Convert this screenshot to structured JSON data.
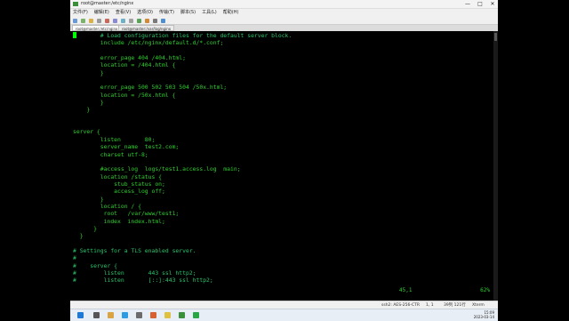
{
  "window": {
    "title": "root@master:/etc/nginx",
    "controls": [
      "—",
      "□",
      "✕"
    ]
  },
  "menu": [
    "文件(F)",
    "编辑(E)",
    "查看(V)",
    "选项(O)",
    "传输(T)",
    "脚本(S)",
    "工具(L)",
    "帮助(H)"
  ],
  "tabs": [
    {
      "label": "root@master:/etc/nginx",
      "active": true
    },
    {
      "label": "root@master:/var/log/nginx",
      "active": false
    }
  ],
  "terminal": {
    "lines": [
      {
        "text": "        # Load configuration files for the default server block.",
        "kind": "comment"
      },
      {
        "text": "        include /etc/nginx/default.d/*.conf;",
        "kind": "code"
      },
      {
        "text": "",
        "kind": "code"
      },
      {
        "text": "        error_page 404 /404.html;",
        "kind": "code"
      },
      {
        "text": "        location = /404.html {",
        "kind": "code"
      },
      {
        "text": "        }",
        "kind": "code"
      },
      {
        "text": "",
        "kind": "code"
      },
      {
        "text": "        error_page 500 502 503 504 /50x.html;",
        "kind": "code"
      },
      {
        "text": "        location = /50x.html {",
        "kind": "code"
      },
      {
        "text": "        }",
        "kind": "code"
      },
      {
        "text": "    }",
        "kind": "code"
      },
      {
        "text": "",
        "kind": "code"
      },
      {
        "text": "",
        "kind": "code"
      },
      {
        "text": "server {",
        "kind": "code"
      },
      {
        "text": "        listen       80;",
        "kind": "code"
      },
      {
        "text": "        server_name  test2.com;",
        "kind": "code"
      },
      {
        "text": "        charset utf-8;",
        "kind": "code"
      },
      {
        "text": "",
        "kind": "code"
      },
      {
        "text": "        #access_log  logs/test1.access.log  main;",
        "kind": "code"
      },
      {
        "text": "        location /status {",
        "kind": "code"
      },
      {
        "text": "            stub_status on;",
        "kind": "code"
      },
      {
        "text": "            access_log off;",
        "kind": "code"
      },
      {
        "text": "        }",
        "kind": "code"
      },
      {
        "text": "        location / {",
        "kind": "code"
      },
      {
        "text": "         root   /var/www/test1;",
        "kind": "code"
      },
      {
        "text": "         index  index.html;",
        "kind": "code"
      },
      {
        "text": "      }",
        "kind": "code"
      },
      {
        "text": "  }",
        "kind": "code"
      },
      {
        "text": "",
        "kind": "code"
      },
      {
        "text": "# Settings for a TLS enabled server.",
        "kind": "comment"
      },
      {
        "text": "#",
        "kind": "comment"
      },
      {
        "text": "#    server {",
        "kind": "comment"
      },
      {
        "text": "#        listen       443 ssl http2;",
        "kind": "comment"
      },
      {
        "text": "#        listen       [::]:443 ssl http2;",
        "kind": "comment"
      }
    ],
    "cursor_pos": "45,1",
    "scroll_pct": "62%"
  },
  "status_bar": {
    "ssh": "ssh2: AES-256-CTR",
    "cursor": "1,  1",
    "size": "39列 121行",
    "term": "Xterm"
  },
  "taskbar": {
    "time": "15:09",
    "date": "2023-03-14"
  },
  "colors": {
    "terminal_fg": "#2fd02f",
    "comment_fg": "#29c46a",
    "terminal_bg": "#000000"
  }
}
